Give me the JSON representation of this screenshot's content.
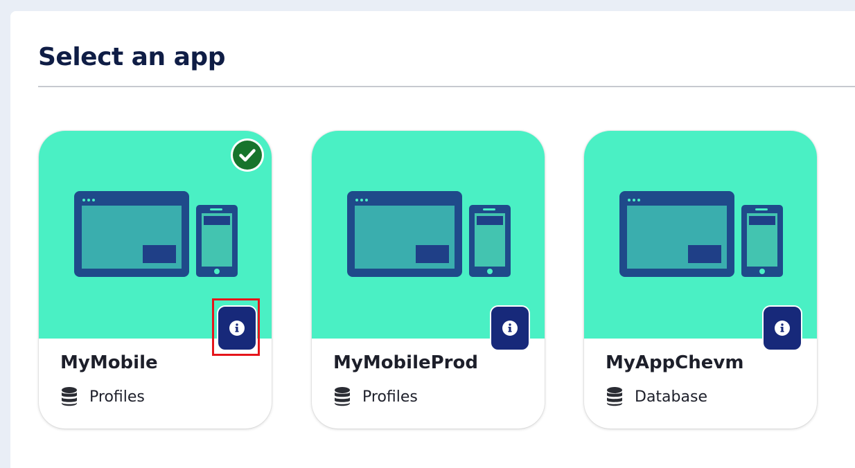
{
  "page": {
    "title": "Select an app"
  },
  "colors": {
    "card_art_bg": "#4af0c4",
    "info_button": "#17297a",
    "selected_check": "#17742c",
    "title": "#0f1d45",
    "highlight": "#e5151b"
  },
  "apps": [
    {
      "name": "MyMobile",
      "type_label": "Profiles",
      "type_icon": "database-icon",
      "selected": true,
      "info_icon": "info-icon"
    },
    {
      "name": "MyMobileProd",
      "type_label": "Profiles",
      "type_icon": "database-icon",
      "selected": false,
      "info_icon": "info-icon"
    },
    {
      "name": "MyAppChevm",
      "type_label": "Database",
      "type_icon": "database-icon",
      "selected": false,
      "info_icon": "info-icon"
    }
  ]
}
